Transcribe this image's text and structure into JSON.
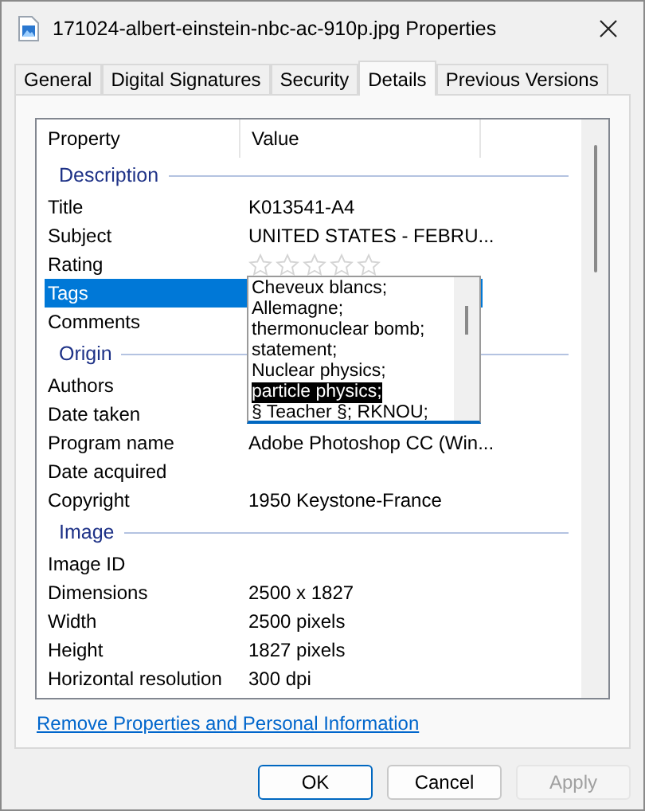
{
  "window": {
    "title": "171024-albert-einstein-nbc-ac-910p.jpg Properties"
  },
  "tabs": [
    {
      "label": "General",
      "selected": false
    },
    {
      "label": "Digital Signatures",
      "selected": false
    },
    {
      "label": "Security",
      "selected": false
    },
    {
      "label": "Details",
      "selected": true
    },
    {
      "label": "Previous Versions",
      "selected": false
    }
  ],
  "details": {
    "columns": [
      "Property",
      "Value"
    ],
    "groups": [
      {
        "title": "Description",
        "rows": [
          {
            "kind": "text",
            "property": "Title",
            "value": "K013541-A4",
            "selected": false
          },
          {
            "kind": "text",
            "property": "Subject",
            "value": "UNITED STATES - FEBRU...",
            "selected": false
          },
          {
            "kind": "rating",
            "property": "Rating",
            "stars": 0,
            "selected": false
          },
          {
            "kind": "tags",
            "property": "Tags",
            "selected": true,
            "tags": [
              {
                "text": "Cheveux blancs;",
                "selected": false
              },
              {
                "text": "Allemagne;",
                "selected": false
              },
              {
                "text": "thermonuclear bomb;",
                "selected": false
              },
              {
                "text": "statement;",
                "selected": false
              },
              {
                "text": "Nuclear physics;",
                "selected": false
              },
              {
                "text": "particle physics;",
                "selected": true
              },
              {
                "text": "§ Teacher §; RKNOU;",
                "selected": false
              }
            ]
          },
          {
            "kind": "text",
            "property": "Comments",
            "selected": false
          }
        ]
      },
      {
        "title": "Origin",
        "rows": [
          {
            "kind": "text",
            "property": "Authors",
            "selected": false
          },
          {
            "kind": "text",
            "property": "Date taken",
            "selected": false
          },
          {
            "kind": "text",
            "property": "Program name",
            "value": "Adobe Photoshop CC (Win...",
            "selected": false
          },
          {
            "kind": "text",
            "property": "Date acquired",
            "selected": false
          },
          {
            "kind": "text",
            "property": "Copyright",
            "value": "1950 Keystone-France",
            "selected": false
          }
        ]
      },
      {
        "title": "Image",
        "rows": [
          {
            "kind": "text",
            "property": "Image ID",
            "selected": false
          },
          {
            "kind": "text",
            "property": "Dimensions",
            "value": "2500 x 1827",
            "selected": false
          },
          {
            "kind": "text",
            "property": "Width",
            "value": "2500 pixels",
            "selected": false
          },
          {
            "kind": "text",
            "property": "Height",
            "value": "1827 pixels",
            "selected": false
          },
          {
            "kind": "text",
            "property": "Horizontal resolution",
            "value": "300 dpi",
            "selected": false
          }
        ]
      }
    ]
  },
  "link": "Remove Properties and Personal Information",
  "buttons": [
    {
      "label": "OK",
      "default": true,
      "disabled": false
    },
    {
      "label": "Cancel",
      "default": false,
      "disabled": false
    },
    {
      "label": "Apply",
      "default": false,
      "disabled": true
    }
  ]
}
